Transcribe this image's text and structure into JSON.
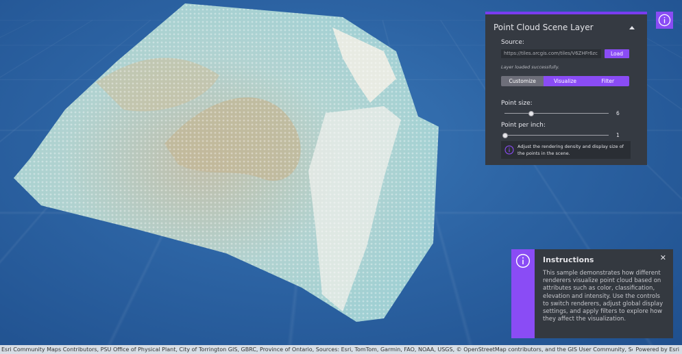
{
  "widget": {
    "title": "Point Cloud Scene Layer",
    "source_label": "Source:",
    "source_url": "https://tiles.arcgis.com/tiles/V6ZHFr6zc",
    "load_label": "Load",
    "status": "Layer loaded successfully.",
    "tabs": [
      {
        "label": "Customize",
        "active": true
      },
      {
        "label": "Visualize",
        "active": false
      },
      {
        "label": "Filter",
        "active": false
      }
    ],
    "point_size": {
      "label": "Point size:",
      "value": "6",
      "fraction": 0.25
    },
    "point_per_inch": {
      "label": "Point per inch:",
      "value": "1",
      "fraction": 0.0
    },
    "note": "Adjust the rendering density and display size of the points in the scene.",
    "accent": "#8a4cf5"
  },
  "instructions": {
    "title": "Instructions",
    "text": "This sample demonstrates how different renderers visualize point cloud based on attributes such as color, classification, elevation and intensity. Use the controls to switch renderers, adjust global display settings, and apply filters to explore how they affect the visualization.",
    "close_icon": "close-icon"
  },
  "attribution": {
    "text": "Esri Community Maps Contributors, PSU Office of Physical Plant, City of Torrington GIS, GBRC, Province of Ontario, Sources: Esri, TomTom, Garmin, FAO, NOAA, USGS, © OpenStreetMap contributors, and the GIS User Community, Sources: Vantor, Airbus D...",
    "powered": "Powered by Esri"
  }
}
